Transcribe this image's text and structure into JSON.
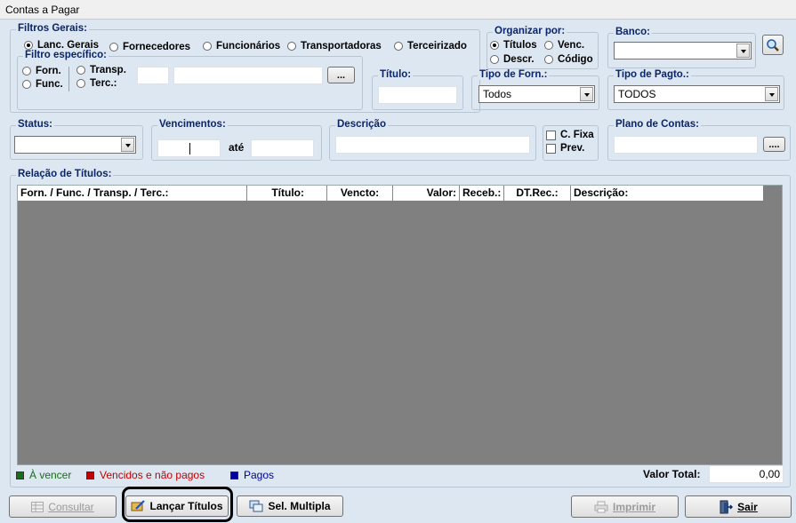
{
  "window": {
    "title": "Contas a Pagar"
  },
  "filtros_gerais": {
    "legend": "Filtros Gerais:",
    "options": [
      "Lanc. Gerais",
      "Fornecedores",
      "Funcionários",
      "Transportadoras",
      "Terceirizado"
    ],
    "selected": "Lanc. Gerais"
  },
  "organizar": {
    "legend": "Organizar por:",
    "options": [
      "Títulos",
      "Venc.",
      "Descr.",
      "Código"
    ],
    "selected": "Títulos"
  },
  "banco": {
    "legend": "Banco:",
    "value": ""
  },
  "filtro_especifico": {
    "legend": "Filtro específico:",
    "options": [
      "Forn.",
      "Transp.",
      "Func.",
      "Terc.:"
    ],
    "browse_label": "..."
  },
  "titulo": {
    "legend": "Título:"
  },
  "tipo_forn": {
    "legend": "Tipo de Forn.:",
    "value": "Todos"
  },
  "tipo_pagto": {
    "legend": "Tipo de Pagto.:",
    "value": "TODOS"
  },
  "status": {
    "legend": "Status:",
    "value": ""
  },
  "vencimentos": {
    "legend": "Vencimentos:",
    "ate": "até"
  },
  "descricao": {
    "legend": "Descrição"
  },
  "flags": {
    "c_fixa": "C. Fixa",
    "prev": "Prev."
  },
  "plano": {
    "legend": "Plano de Contas:",
    "browse_label": "...."
  },
  "relacao": {
    "legend": "Relação de Títulos:",
    "columns": [
      "Forn. / Func. / Transp. / Terc.:",
      "Título:",
      "Vencto:",
      "Valor:",
      "Receb.:",
      "DT.Rec.:",
      "Descrição:"
    ]
  },
  "status_legend": [
    {
      "label": "À vencer",
      "color": "#1a6b1a"
    },
    {
      "label": "Vencidos e não pagos",
      "color": "#c00000"
    },
    {
      "label": "Pagos",
      "color": "#0000a0"
    }
  ],
  "total": {
    "label": "Valor Total:",
    "value": "0,00"
  },
  "buttons": {
    "consultar": "Consultar",
    "lancar": "Lançar Títulos",
    "sel_multipla": "Sel. Multipla",
    "imprimir": "Imprimir",
    "sair": "Sair"
  }
}
